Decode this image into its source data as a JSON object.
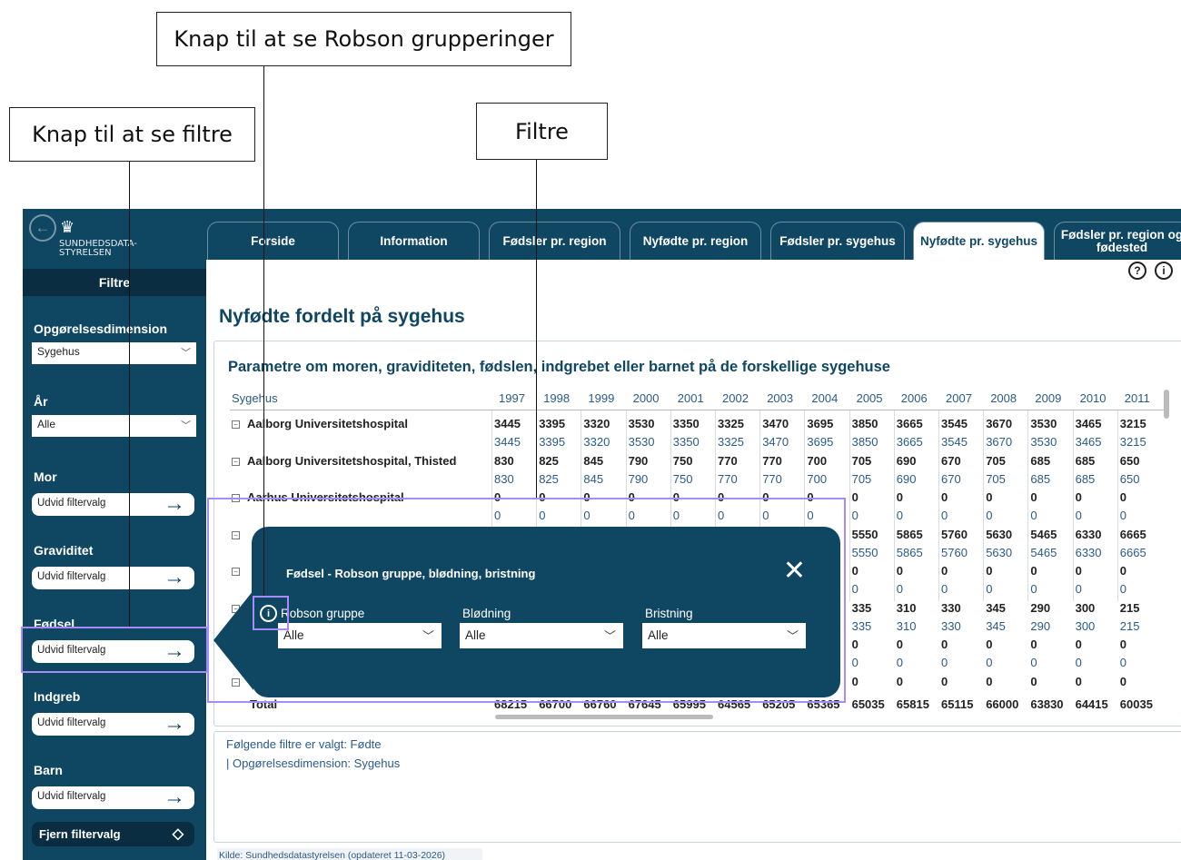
{
  "callouts": {
    "robson": "Knap til at se Robson grupperinger",
    "filters_btn": "Knap til at se filtre",
    "filters": "Filtre"
  },
  "sidebar": {
    "logo_line1": "SUNDHEDSDATA-",
    "logo_line2": "STYRELSEN",
    "filtre_header": "Filtre",
    "opgorelse_label": "Opgørelsesdimension",
    "opgorelse_value": "Sygehus",
    "aar_label": "År",
    "aar_value": "Alle",
    "mor_label": "Mor",
    "graviditet_label": "Graviditet",
    "fodsel_label": "Fødsel",
    "indgreb_label": "Indgreb",
    "barn_label": "Barn",
    "expand_label": "Udvid filtervalg",
    "clear_label": "Fjern filtervalg"
  },
  "tabs": [
    {
      "label": "Forside"
    },
    {
      "label": "Information"
    },
    {
      "label": "Fødsler pr. region"
    },
    {
      "label": "Nyfødte pr. region"
    },
    {
      "label": "Fødsler pr. sygehus"
    },
    {
      "label": "Nyfødte pr. sygehus"
    },
    {
      "label": "Fødsler pr. region og fødested"
    }
  ],
  "page_title": "Nyfødte fordelt på sygehus",
  "panel_title": "Parametre om moren, graviditeten, fødslen, indgrebet eller barnet på de forskellige sygehuse",
  "table": {
    "header_col": "Sygehus",
    "years": [
      "1997",
      "1998",
      "1999",
      "2000",
      "2001",
      "2002",
      "2003",
      "2004",
      "2005",
      "2006",
      "2007",
      "2008",
      "2009",
      "2010",
      "2011"
    ],
    "rows": [
      {
        "name": "Aalborg Universitetshospital",
        "bold": [
          "3445",
          "3395",
          "3320",
          "3530",
          "3350",
          "3325",
          "3470",
          "3695",
          "3850",
          "3665",
          "3545",
          "3670",
          "3530",
          "3465",
          "3215"
        ],
        "sub": [
          "3445",
          "3395",
          "3320",
          "3530",
          "3350",
          "3325",
          "3470",
          "3695",
          "3850",
          "3665",
          "3545",
          "3670",
          "3530",
          "3465",
          "3215"
        ]
      },
      {
        "name": "Aalborg Universitetshospital, Thisted",
        "bold": [
          "830",
          "825",
          "845",
          "790",
          "750",
          "770",
          "770",
          "700",
          "705",
          "690",
          "670",
          "705",
          "685",
          "685",
          "650"
        ],
        "sub": [
          "830",
          "825",
          "845",
          "790",
          "750",
          "770",
          "770",
          "700",
          "705",
          "690",
          "670",
          "705",
          "685",
          "685",
          "650"
        ]
      },
      {
        "name": "Aarhus Universitetshospital",
        "bold": [
          "0",
          "0",
          "0",
          "0",
          "0",
          "0",
          "0",
          "0",
          "0",
          "0",
          "0",
          "0",
          "0",
          "0",
          "0"
        ],
        "sub": [
          "0",
          "0",
          "0",
          "0",
          "0",
          "0",
          "0",
          "0",
          "0",
          "0",
          "0",
          "0",
          "0",
          "0",
          "0"
        ]
      },
      {
        "name": "",
        "bold": [
          "",
          "",
          "",
          "",
          "",
          "",
          "",
          "",
          "5550",
          "5865",
          "5760",
          "5630",
          "5465",
          "6330",
          "6665"
        ],
        "sub": [
          "",
          "",
          "",
          "",
          "",
          "",
          "",
          "",
          "5550",
          "5865",
          "5760",
          "5630",
          "5465",
          "6330",
          "6665"
        ]
      },
      {
        "name": "",
        "bold": [
          "",
          "",
          "",
          "",
          "",
          "",
          "",
          "",
          "0",
          "0",
          "0",
          "0",
          "0",
          "0",
          "0"
        ],
        "sub": [
          "",
          "",
          "",
          "",
          "",
          "",
          "",
          "",
          "0",
          "0",
          "0",
          "0",
          "0",
          "0",
          "0"
        ]
      },
      {
        "name": "",
        "bold": [
          "",
          "",
          "",
          "",
          "",
          "",
          "",
          "",
          "335",
          "310",
          "330",
          "345",
          "290",
          "300",
          "215"
        ],
        "sub": [
          "",
          "",
          "",
          "",
          "",
          "",
          "",
          "",
          "335",
          "310",
          "330",
          "345",
          "290",
          "300",
          "215"
        ]
      },
      {
        "name": "",
        "bold": [
          "",
          "",
          "",
          "",
          "",
          "",
          "",
          "",
          "0",
          "0",
          "0",
          "0",
          "0",
          "0",
          "0"
        ],
        "sub": [
          "",
          "",
          "",
          "",
          "",
          "",
          "",
          "",
          "0",
          "0",
          "0",
          "0",
          "0",
          "0",
          "0"
        ]
      },
      {
        "name": "",
        "bold": [
          "",
          "",
          "",
          "",
          "",
          "",
          "",
          "",
          "0",
          "0",
          "0",
          "0",
          "0",
          "0",
          "0"
        ],
        "sub": []
      }
    ],
    "total_label": "Total",
    "totals": [
      "68215",
      "66700",
      "66760",
      "67645",
      "65995",
      "64565",
      "65205",
      "65365",
      "65035",
      "65815",
      "65115",
      "66000",
      "63830",
      "64415",
      "60035"
    ]
  },
  "filters_text": {
    "line1": "Følgende filtre er valgt: Fødte",
    "line2": "| Opgørelsesdimension: Sygehus"
  },
  "source": "Kilde: Sundhedsdatastyrelsen (opdateret 11-03-2026)",
  "popup": {
    "title": "Fødsel - Robson gruppe, blødning, bristning",
    "fields": [
      {
        "label": "Robson gruppe",
        "value": "Alle"
      },
      {
        "label": "Blødning",
        "value": "Alle"
      },
      {
        "label": "Bristning",
        "value": "Alle"
      }
    ]
  },
  "colors": {
    "brand": "#0f4763",
    "highlight": "#a78bfa",
    "link_blue": "#2a5a8a"
  }
}
